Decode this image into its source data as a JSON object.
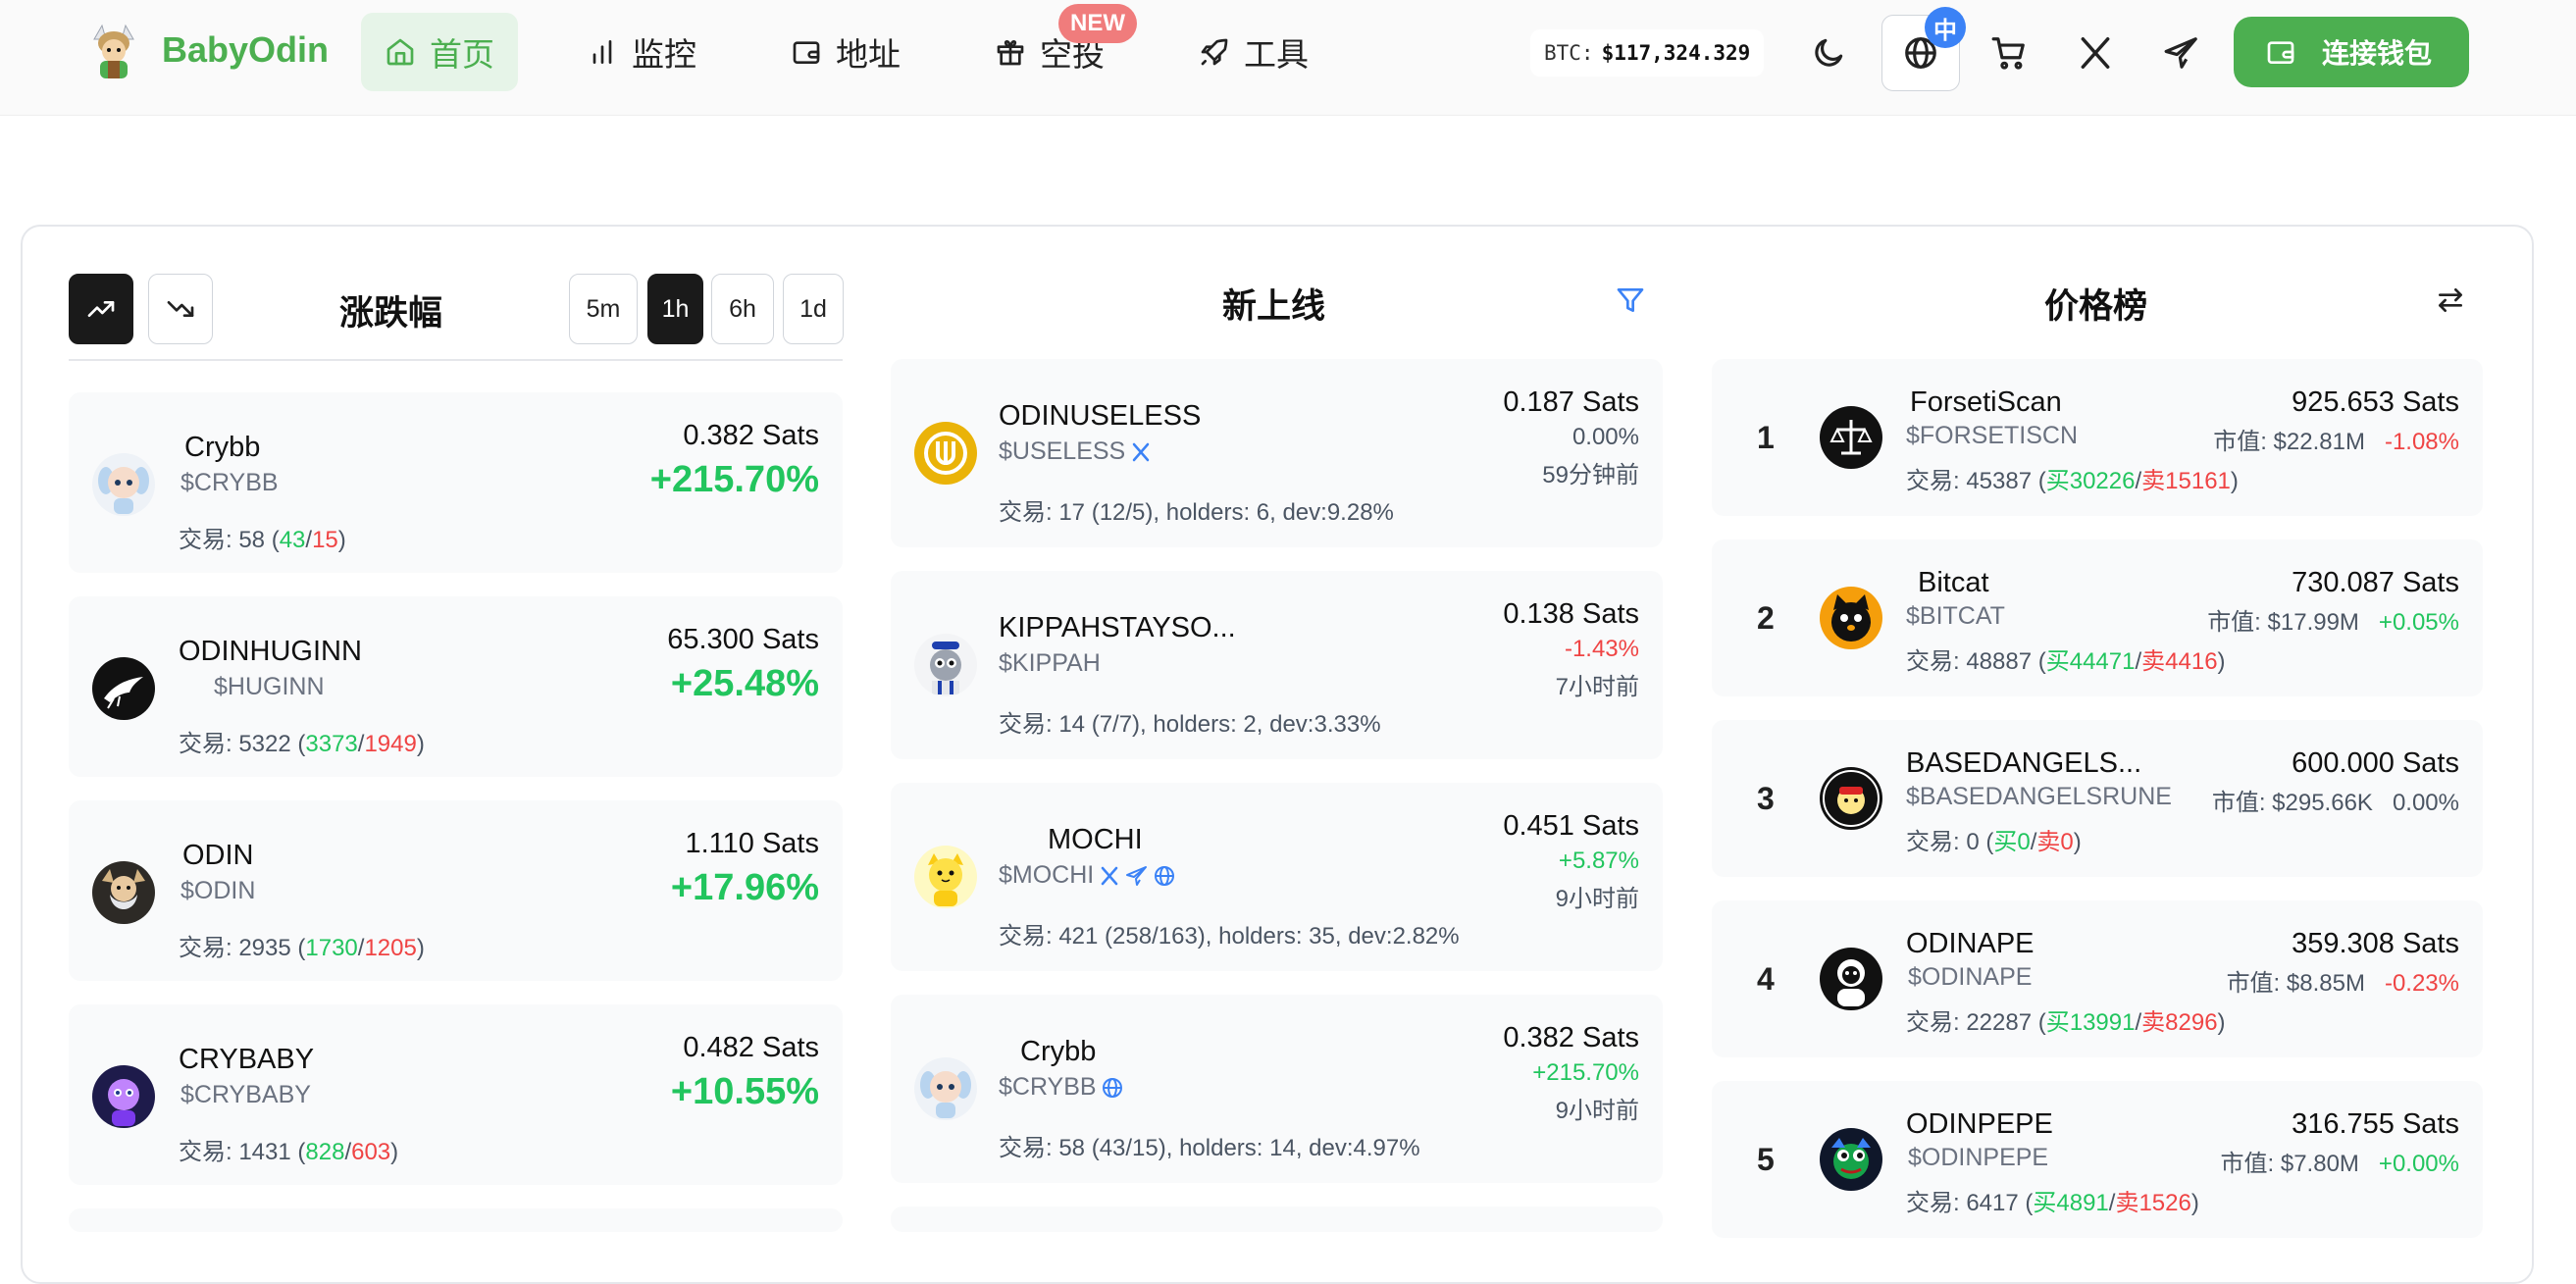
{
  "header": {
    "brand": "BabyOdin",
    "nav": [
      {
        "label": "首页",
        "icon": "home-icon",
        "active": true
      },
      {
        "label": "监控",
        "icon": "bar-chart-icon"
      },
      {
        "label": "地址",
        "icon": "wallet-icon"
      },
      {
        "label": "空投",
        "icon": "gift-icon",
        "badge": "NEW"
      },
      {
        "label": "工具",
        "icon": "rocket-icon"
      }
    ],
    "btc_label": "BTC:",
    "btc_value": "$117,324.329",
    "lang_badge": "中",
    "connect_label": "连接钱包"
  },
  "gainers": {
    "title": "涨跌幅",
    "timeframes": [
      "5m",
      "1h",
      "6h",
      "1d"
    ],
    "active_timeframe": "1h",
    "items": [
      {
        "name": "Crybb",
        "symbol": "$CRYBB",
        "price": "0.382 Sats",
        "change": "+215.70%",
        "trades_label": "交易: 58 (",
        "buys": "43",
        "sep": "/",
        "sells": "15",
        "close": ")"
      },
      {
        "name": "ODINHUGINN",
        "symbol": "$HUGINN",
        "price": "65.300 Sats",
        "change": "+25.48%",
        "trades_label": "交易: 5322 (",
        "buys": "3373",
        "sep": "/",
        "sells": "1949",
        "close": ")"
      },
      {
        "name": "ODIN",
        "symbol": "$ODIN",
        "price": "1.110 Sats",
        "change": "+17.96%",
        "trades_label": "交易: 2935 (",
        "buys": "1730",
        "sep": "/",
        "sells": "1205",
        "close": ")"
      },
      {
        "name": "CRYBABY",
        "symbol": "$CRYBABY",
        "price": "0.482 Sats",
        "change": "+10.55%",
        "trades_label": "交易: 1431 (",
        "buys": "828",
        "sep": "/",
        "sells": "603",
        "close": ")"
      }
    ]
  },
  "new_listings": {
    "title": "新上线",
    "items": [
      {
        "name": "ODINUSELESS",
        "symbol": "$USELESS",
        "price": "0.187 Sats",
        "change": "0.00%",
        "ago": "59分钟前",
        "stats": "交易: 17 (12/5), holders: 6, dev:9.28%"
      },
      {
        "name": "KIPPAHSTAYSO...",
        "symbol": "$KIPPAH",
        "price": "0.138 Sats",
        "change": "-1.43%",
        "ago": "7小时前",
        "stats": "交易: 14 (7/7), holders: 2, dev:3.33%"
      },
      {
        "name": "MOCHI",
        "symbol": "$MOCHI",
        "price": "0.451 Sats",
        "change": "+5.87%",
        "ago": "9小时前",
        "stats": "交易: 421 (258/163), holders: 35, dev:2.82%"
      },
      {
        "name": "Crybb",
        "symbol": "$CRYBB",
        "price": "0.382 Sats",
        "change": "+215.70%",
        "ago": "9小时前",
        "stats": "交易: 58 (43/15), holders: 14, dev:4.97%"
      }
    ]
  },
  "price_rank": {
    "title": "价格榜",
    "items": [
      {
        "rank": "1",
        "name": "ForsetiScan",
        "symbol": "$FORSETISCN",
        "price": "925.653 Sats",
        "mcap": "市值: $22.81M",
        "change": "-1.08%",
        "trades_label": "交易: 45387 (",
        "buys": "买30226",
        "sep": "/",
        "sells": "卖15161",
        "close": ")"
      },
      {
        "rank": "2",
        "name": "Bitcat",
        "symbol": "$BITCAT",
        "price": "730.087 Sats",
        "mcap": "市值: $17.99M",
        "change": "+0.05%",
        "trades_label": "交易: 48887 (",
        "buys": "买44471",
        "sep": "/",
        "sells": "卖4416",
        "close": ")"
      },
      {
        "rank": "3",
        "name": "BASEDANGELS...",
        "symbol": "$BASEDANGELSRUNE",
        "price": "600.000 Sats",
        "mcap": "市值: $295.66K",
        "change": "0.00%",
        "trades_label": "交易: 0 (",
        "buys": "买0",
        "sep": "/",
        "sells": "卖0",
        "close": ")"
      },
      {
        "rank": "4",
        "name": "ODINAPE",
        "symbol": "$ODINAPE",
        "price": "359.308 Sats",
        "mcap": "市值: $8.85M",
        "change": "-0.23%",
        "trades_label": "交易: 22287 (",
        "buys": "买13991",
        "sep": "/",
        "sells": "卖8296",
        "close": ")"
      },
      {
        "rank": "5",
        "name": "ODINPEPE",
        "symbol": "$ODINPEPE",
        "price": "316.755 Sats",
        "mcap": "市值: $7.80M",
        "change": "+0.00%",
        "trades_label": "交易: 6417 (",
        "buys": "买4891",
        "sep": "/",
        "sells": "卖1526",
        "close": ")"
      }
    ]
  },
  "colors": {
    "brand": "#4caf50",
    "up": "#22c55e",
    "down": "#ef4444",
    "accent": "#3b82f6"
  }
}
